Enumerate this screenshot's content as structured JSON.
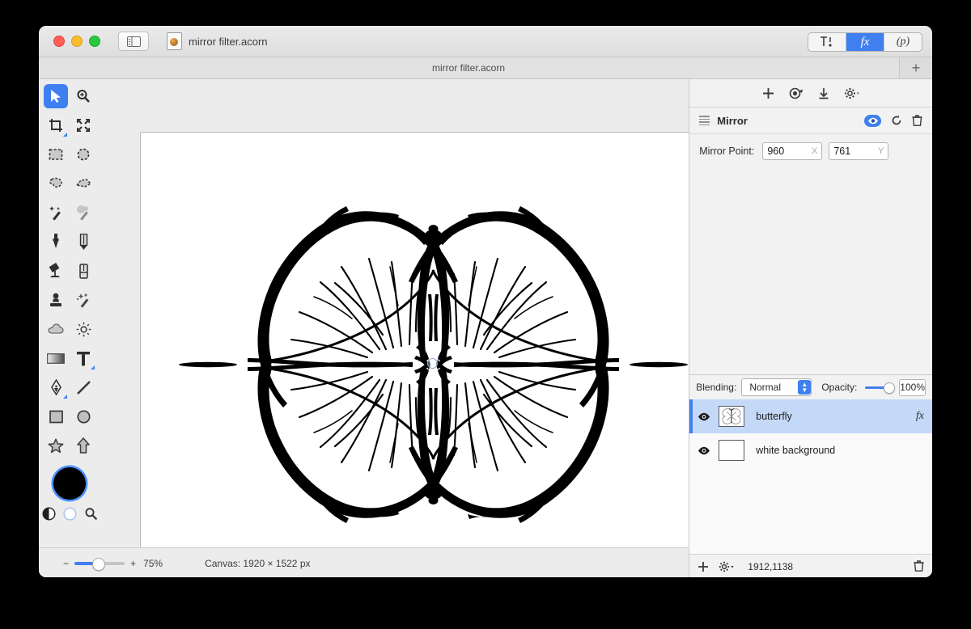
{
  "window": {
    "title": "mirror filter.acorn",
    "traffic_lights": [
      "close",
      "minimize",
      "zoom"
    ],
    "sidebar_toggle_icon": "sidebar-toggle-icon",
    "doc_icon": "acorn-document-icon"
  },
  "mode_segments": [
    {
      "name": "tools",
      "label": "",
      "icon": "tools-icon",
      "selected": false
    },
    {
      "name": "filters",
      "label": "fx",
      "selected": true
    },
    {
      "name": "presets",
      "label": "(p)",
      "selected": false
    }
  ],
  "tabbar": {
    "active_tab": "mirror filter.acorn",
    "new_tab_label": "+"
  },
  "tools": {
    "rows": [
      [
        {
          "name": "move-tool",
          "icon": "cursor-arrow-icon",
          "selected": true
        },
        {
          "name": "zoom-tool",
          "icon": "magnifier-plus-icon",
          "selected": false
        }
      ],
      [
        {
          "name": "crop-tool",
          "icon": "crop-icon",
          "selected": false,
          "has_submenu": true
        },
        {
          "name": "transform-tool",
          "icon": "move-arrows-icon",
          "selected": false
        }
      ],
      [
        {
          "name": "rectangle-select-tool",
          "icon": "marquee-rect-icon",
          "selected": false
        },
        {
          "name": "ellipse-select-tool",
          "icon": "marquee-ellipse-icon",
          "selected": false
        }
      ],
      [
        {
          "name": "lasso-tool",
          "icon": "lasso-icon",
          "selected": false
        },
        {
          "name": "polygon-lasso-tool",
          "icon": "polygon-lasso-icon",
          "selected": false
        }
      ],
      [
        {
          "name": "magic-wand-tool",
          "icon": "magic-wand-icon",
          "selected": false
        },
        {
          "name": "instant-alpha-tool",
          "icon": "instant-alpha-icon",
          "selected": false
        }
      ],
      [
        {
          "name": "brush-tool",
          "icon": "brush-icon",
          "selected": false
        },
        {
          "name": "pencil-tool",
          "icon": "pencil-icon",
          "selected": false
        }
      ],
      [
        {
          "name": "paint-bucket-tool",
          "icon": "paint-bucket-icon",
          "selected": false
        },
        {
          "name": "eraser-tool",
          "icon": "eraser-icon",
          "selected": false
        }
      ],
      [
        {
          "name": "clone-stamp-tool",
          "icon": "clone-stamp-icon",
          "selected": false
        },
        {
          "name": "smudge-tool",
          "icon": "sparkle-smudge-icon",
          "selected": false
        }
      ],
      [
        {
          "name": "blur-tool",
          "icon": "cloud-blur-icon",
          "selected": false
        },
        {
          "name": "dodge-tool",
          "icon": "sun-dodge-icon",
          "selected": false
        }
      ],
      [
        {
          "name": "gradient-tool",
          "icon": "gradient-icon",
          "selected": false
        },
        {
          "name": "text-tool",
          "icon": "text-t-icon",
          "selected": false,
          "has_submenu": true
        }
      ],
      [
        {
          "name": "pen-tool",
          "icon": "pen-nib-icon",
          "selected": false,
          "has_submenu": true
        },
        {
          "name": "line-tool",
          "icon": "line-icon",
          "selected": false
        }
      ],
      [
        {
          "name": "rectangle-shape-tool",
          "icon": "square-icon",
          "selected": false
        },
        {
          "name": "ellipse-shape-tool",
          "icon": "circle-icon",
          "selected": false
        }
      ],
      [
        {
          "name": "star-shape-tool",
          "icon": "star-icon",
          "selected": false
        },
        {
          "name": "arrow-shape-tool",
          "icon": "arrow-up-icon",
          "selected": false
        }
      ]
    ],
    "color_well": {
      "name": "foreground-color-well",
      "color": "#000000",
      "focus_ring": "#4a90ff"
    },
    "mini_icons": [
      {
        "name": "invert-colors-icon"
      },
      {
        "name": "background-color-well"
      },
      {
        "name": "color-picker-magnifier-icon"
      }
    ]
  },
  "canvas": {
    "mirror_handle": "mirror-point-handle",
    "artwork": "butterfly-line-art"
  },
  "statusbar": {
    "zoom_minus": "−",
    "zoom_plus": "+",
    "zoom_level": "75%",
    "canvas_info": "Canvas: 1920 × 1522 px"
  },
  "filters_panel": {
    "toolbar_icons": [
      {
        "name": "add-filter-icon",
        "glyph": "+"
      },
      {
        "name": "filter-preview-icon"
      },
      {
        "name": "download-filter-icon"
      },
      {
        "name": "filter-settings-gear-icon"
      }
    ],
    "filter": {
      "name": "Mirror",
      "enabled_icon": "eye-icon",
      "reset_icon": "reset-arrow-icon",
      "delete_icon": "trash-icon",
      "params": [
        {
          "label": "Mirror Point:",
          "x": {
            "value": "960",
            "unit": "X"
          },
          "y": {
            "value": "761",
            "unit": "Y"
          }
        }
      ]
    }
  },
  "layers_panel": {
    "blending_label": "Blending:",
    "blending_value": "Normal",
    "opacity_label": "Opacity:",
    "opacity_value": "100%",
    "layers": [
      {
        "name": "butterfly",
        "selected": true,
        "visible": true,
        "has_fx": true,
        "fx_label": "fx",
        "thumb": "butterfly-thumbnail"
      },
      {
        "name": "white background",
        "selected": false,
        "visible": true,
        "has_fx": false,
        "thumb": "white-thumbnail"
      }
    ],
    "footer": {
      "add_icon": "add-layer-icon",
      "gear_icon": "layer-settings-gear-icon",
      "coords": "1912,1138",
      "trash_icon": "delete-layer-icon"
    }
  },
  "colors": {
    "accent": "#3f7fef",
    "selection": "#c4d8f8",
    "chrome": "#ececec"
  }
}
